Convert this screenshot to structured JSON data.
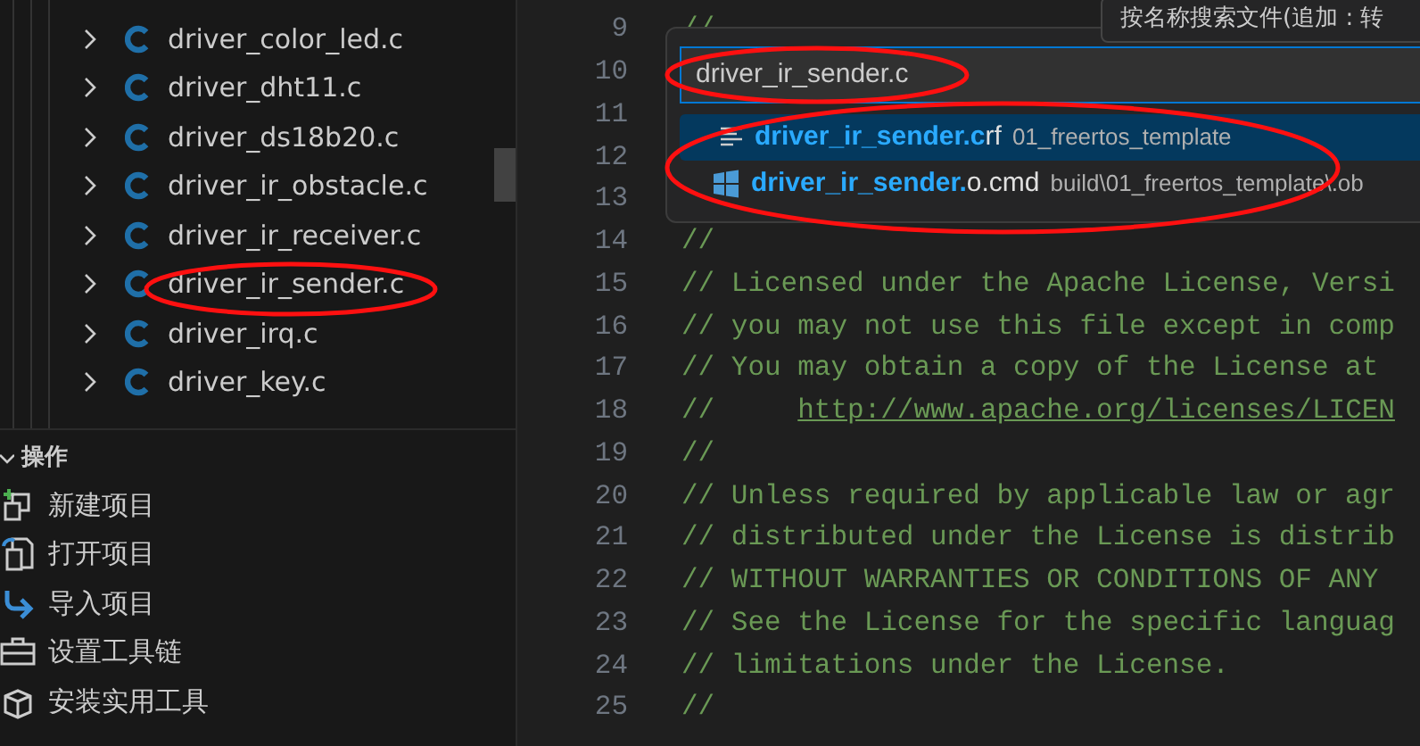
{
  "explorer": {
    "files": [
      {
        "name": "driver_color_led.c"
      },
      {
        "name": "driver_dht11.c"
      },
      {
        "name": "driver_ds18b20.c"
      },
      {
        "name": "driver_ir_obstacle.c"
      },
      {
        "name": "driver_ir_receiver.c"
      },
      {
        "name": "driver_ir_sender.c"
      },
      {
        "name": "driver_irq.c"
      },
      {
        "name": "driver_key.c"
      }
    ]
  },
  "actions": {
    "title": "操作",
    "expanded": true,
    "items": [
      {
        "label": "新建项目",
        "kind": "new"
      },
      {
        "label": "打开项目",
        "kind": "open"
      },
      {
        "label": "导入项目",
        "kind": "import"
      },
      {
        "label": "设置工具链",
        "kind": "toolbox"
      },
      {
        "label": "安装实用工具",
        "kind": "package"
      }
    ]
  },
  "editor": {
    "lines": [
      {
        "number": "9",
        "text": "//"
      },
      {
        "number": "10"
      },
      {
        "number": "11"
      },
      {
        "number": "12"
      },
      {
        "number": "13"
      },
      {
        "number": "14",
        "text": "//"
      },
      {
        "number": "15",
        "text": "// Licensed under the Apache License, Versi"
      },
      {
        "number": "16",
        "text": "// you may not use this file except in comp"
      },
      {
        "number": "17",
        "text": "// You may obtain a copy of the License at"
      },
      {
        "number": "18",
        "text": "//     ",
        "link": "http://www.apache.org/licenses/LICEN"
      },
      {
        "number": "19",
        "text": "//"
      },
      {
        "number": "20",
        "text": "// Unless required by applicable law or agr"
      },
      {
        "number": "21",
        "text": "// distributed under the License is distrib"
      },
      {
        "number": "22",
        "text": "// WITHOUT WARRANTIES OR CONDITIONS OF ANY"
      },
      {
        "number": "23",
        "text": "// See the License for the specific languag"
      },
      {
        "number": "24",
        "text": "// limitations under the License."
      },
      {
        "number": "25",
        "text": "//"
      }
    ]
  },
  "quick_open": {
    "value": "driver_ir_sender.c",
    "tooltip": "按名称搜索文件(追加 : 转",
    "results": [
      {
        "match": "driver_ir_sender.c",
        "rest": "rf",
        "description": "01_freertos_template",
        "kind": "text",
        "selected": true
      },
      {
        "match": "driver_ir_sender.",
        "rest": "o.cmd",
        "description": "build\\01_freertos_template\\.ob",
        "kind": "windows",
        "selected": false
      }
    ]
  }
}
